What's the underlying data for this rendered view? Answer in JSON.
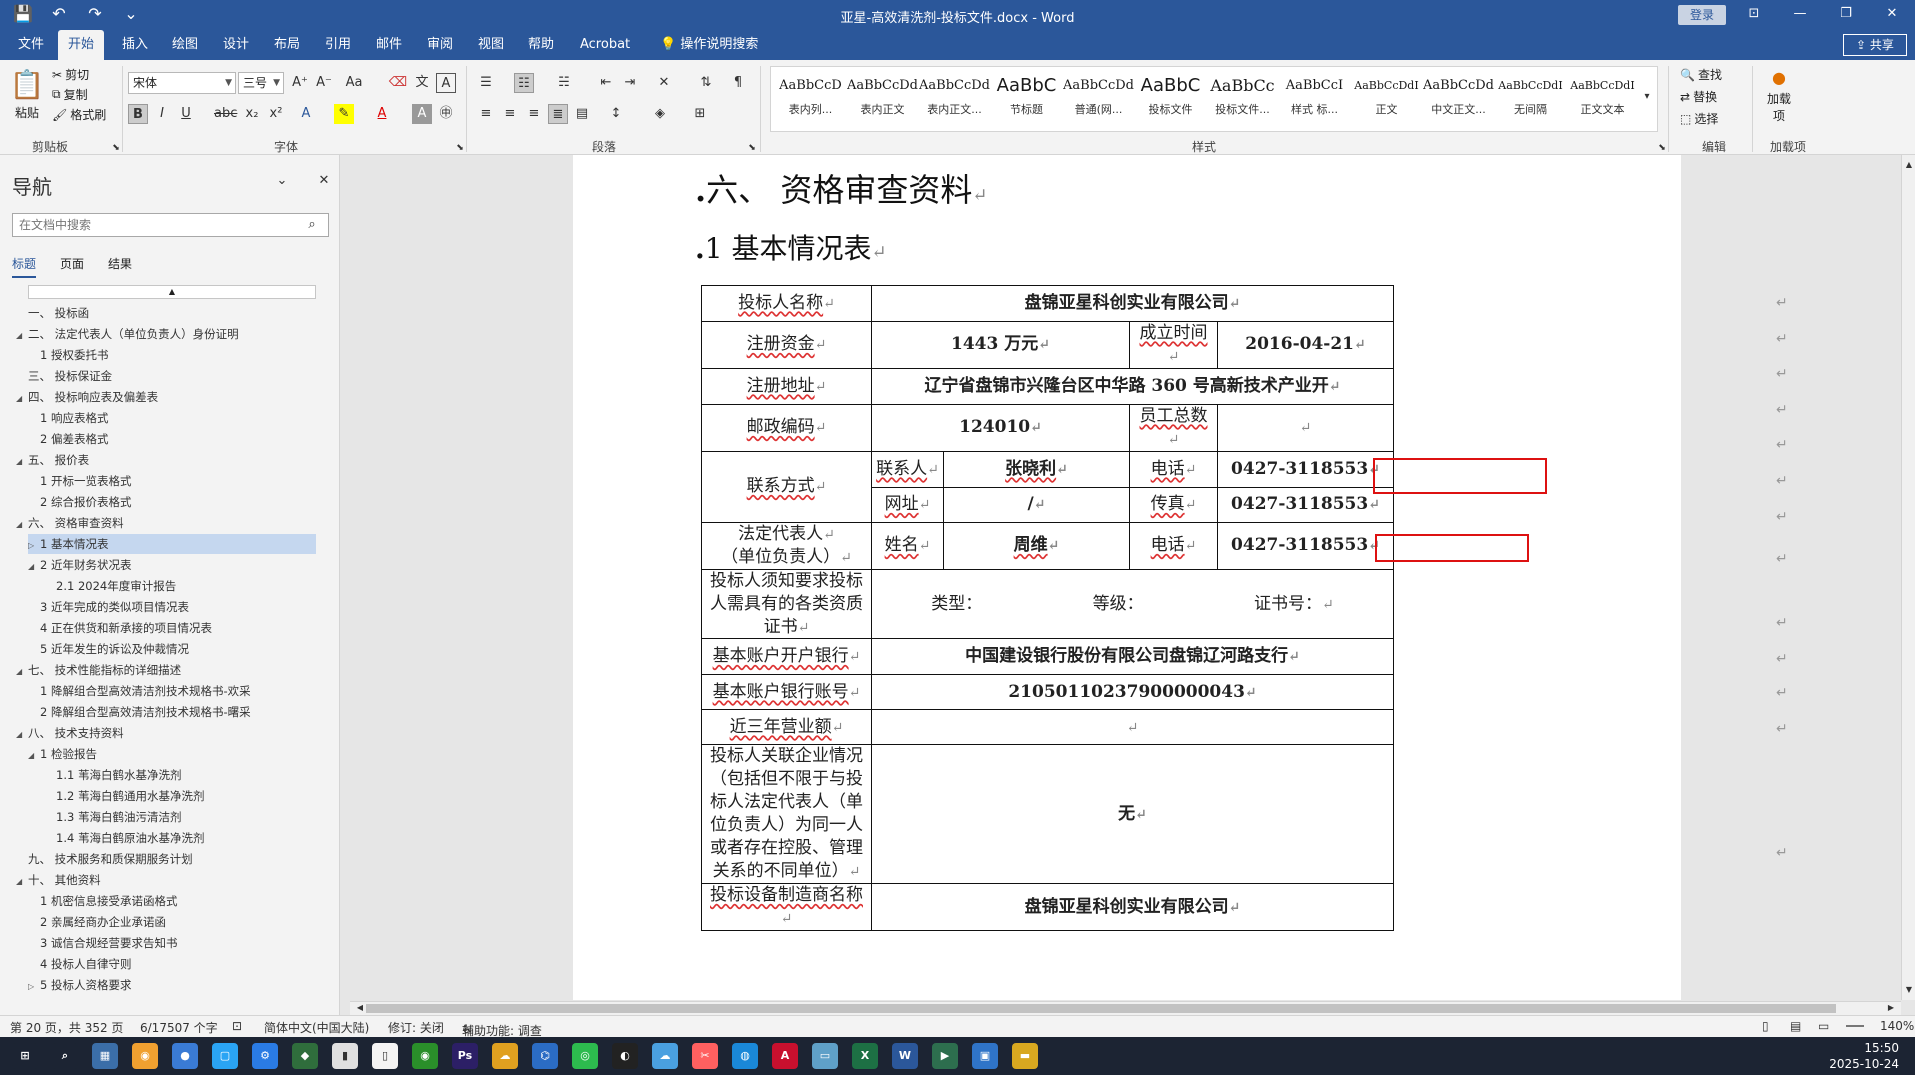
{
  "titlebar": {
    "title": "亚星-高效清洗剂-投标文件.docx  -  Word",
    "login": "登录",
    "qat": [
      "💾",
      "↶",
      "↷",
      "⌄"
    ],
    "win": [
      "⊡",
      "—",
      "❐",
      "✕"
    ]
  },
  "tabs": [
    "文件",
    "开始",
    "插入",
    "绘图",
    "设计",
    "布局",
    "引用",
    "邮件",
    "审阅",
    "视图",
    "帮助",
    "Acrobat",
    "操作说明搜索"
  ],
  "share": "共享",
  "ribbon": {
    "clipboard": {
      "paste": "粘贴",
      "cut": "剪切",
      "copy": "复制",
      "format_painter": "格式刷",
      "label": "剪贴板"
    },
    "font": {
      "name": "宋体",
      "size": "三号",
      "label": "字体"
    },
    "paragraph": {
      "label": "段落"
    },
    "styles_label": "样式",
    "styles": [
      {
        "sample": "AaBbCcD",
        "name": "表内列..."
      },
      {
        "sample": "AaBbCcDd",
        "name": "表内正文"
      },
      {
        "sample": "AaBbCcDd",
        "name": "表内正文..."
      },
      {
        "sample": "AaBbC",
        "name": "节标题"
      },
      {
        "sample": "AaBbCcDd",
        "name": "普通(网..."
      },
      {
        "sample": "AaBbC",
        "name": "投标文件"
      },
      {
        "sample": "AaBbCc",
        "name": "投标文件..."
      },
      {
        "sample": "AaBbCcI",
        "name": "样式 标..."
      },
      {
        "sample": "AaBbCcDdI",
        "name": "正文"
      },
      {
        "sample": "AaBbCcDd",
        "name": "中文正文..."
      },
      {
        "sample": "AaBbCcDdI",
        "name": "无间隔"
      },
      {
        "sample": "AaBbCcDdI",
        "name": "正文文本"
      }
    ],
    "editing": {
      "find": "查找",
      "replace": "替换",
      "select": "选择",
      "label": "编辑"
    },
    "addins": {
      "add": "加载项",
      "label": "加载项"
    }
  },
  "nav": {
    "title": "导航",
    "search_placeholder": "在文档中搜索",
    "tabs": [
      "标题",
      "页面",
      "结果"
    ],
    "items": [
      {
        "t": "一、 投标函",
        "lv": 0,
        "tw": ""
      },
      {
        "t": "二、 法定代表人（单位负责人）身份证明",
        "lv": 0,
        "tw": "◢"
      },
      {
        "t": "1 授权委托书",
        "lv": 1,
        "tw": ""
      },
      {
        "t": "三、 投标保证金",
        "lv": 0,
        "tw": ""
      },
      {
        "t": "四、 投标响应表及偏差表",
        "lv": 0,
        "tw": "◢"
      },
      {
        "t": "1 响应表格式",
        "lv": 1,
        "tw": ""
      },
      {
        "t": "2 偏差表格式",
        "lv": 1,
        "tw": ""
      },
      {
        "t": "五、 报价表",
        "lv": 0,
        "tw": "◢"
      },
      {
        "t": "1 开标一览表格式",
        "lv": 1,
        "tw": ""
      },
      {
        "t": "2 综合报价表格式",
        "lv": 1,
        "tw": ""
      },
      {
        "t": "六、 资格审查资料",
        "lv": 0,
        "tw": "◢"
      },
      {
        "t": "1 基本情况表",
        "lv": 1,
        "tw": "▷",
        "sel": true
      },
      {
        "t": "2 近年财务状况表",
        "lv": 1,
        "tw": "◢"
      },
      {
        "t": "2.1 2024年度审计报告",
        "lv": 2,
        "tw": ""
      },
      {
        "t": "3 近年完成的类似项目情况表",
        "lv": 1,
        "tw": ""
      },
      {
        "t": "4 正在供货和新承接的项目情况表",
        "lv": 1,
        "tw": ""
      },
      {
        "t": "5 近年发生的诉讼及仲裁情况",
        "lv": 1,
        "tw": ""
      },
      {
        "t": "七、 技术性能指标的详细描述",
        "lv": 0,
        "tw": "◢"
      },
      {
        "t": "1 降解组合型高效清洁剂技术规格书-欢采",
        "lv": 1,
        "tw": ""
      },
      {
        "t": "2 降解组合型高效清洁剂技术规格书-曙采",
        "lv": 1,
        "tw": ""
      },
      {
        "t": "八、 技术支持资料",
        "lv": 0,
        "tw": "◢"
      },
      {
        "t": "1 检验报告",
        "lv": 1,
        "tw": "◢"
      },
      {
        "t": "1.1 苇海白鹤水基净洗剂",
        "lv": 2,
        "tw": ""
      },
      {
        "t": "1.2 苇海白鹤通用水基净洗剂",
        "lv": 2,
        "tw": ""
      },
      {
        "t": "1.3 苇海白鹤油污清洁剂",
        "lv": 2,
        "tw": ""
      },
      {
        "t": "1.4 苇海白鹤原油水基净洗剂",
        "lv": 2,
        "tw": ""
      },
      {
        "t": "九、 技术服务和质保期服务计划",
        "lv": 0,
        "tw": ""
      },
      {
        "t": "十、 其他资料",
        "lv": 0,
        "tw": "◢"
      },
      {
        "t": "1 机密信息接受承诺函格式",
        "lv": 1,
        "tw": ""
      },
      {
        "t": "2 亲属经商办企业承诺函",
        "lv": 1,
        "tw": ""
      },
      {
        "t": "3 诚信合规经营要求告知书",
        "lv": 1,
        "tw": ""
      },
      {
        "t": "4 投标人自律守则",
        "lv": 1,
        "tw": ""
      },
      {
        "t": "5 投标人资格要求",
        "lv": 1,
        "tw": "▷"
      }
    ]
  },
  "doc": {
    "h1": "六、 资格审查资料",
    "h2": "1   基本情况表",
    "table": {
      "bidder_label": "投标人名称",
      "bidder": "盘锦亚星科创实业有限公司",
      "capital_label": "注册资金",
      "capital": "1443 万元",
      "established_label": "成立时间",
      "established": "2016-04-21",
      "address_label": "注册地址",
      "address": "辽宁省盘锦市兴隆台区中华路 360 号高新技术产业开",
      "postcode_label": "邮政编码",
      "postcode": "124010",
      "staff_label": "员工总数",
      "staff": "",
      "contact_label": "联系方式",
      "contact_person_label": "联系人",
      "contact_person": "张晓利",
      "phone_label": "电话",
      "phone": "0427-3118553",
      "website_label": "网址",
      "website": "/",
      "fax_label": "传真",
      "fax": "0427-3118553",
      "legal_rep_label_1": "法定代表人",
      "legal_rep_label_2": "（单位负责人）",
      "name_label": "姓名",
      "name": "周维",
      "phone2_label": "电话",
      "phone2": "0427-3118553",
      "qual_label": "投标人须知要求投标人需具有的各类资质证书",
      "qual_type": "类型：",
      "qual_grade": "等级：",
      "qual_cert": "证书号：",
      "bank_label": "基本账户开户银行",
      "bank": "中国建设银行股份有限公司盘锦辽河路支行",
      "account_label": "基本账户银行账号",
      "account": "21050110237900000043",
      "revenue_label": "近三年营业额",
      "revenue": "",
      "related_label": "投标人关联企业情况（包括但不限于与投标人法定代表人（单位负责人）为同一人或者存在控股、管理关系的不同单位）",
      "related": "无",
      "maker_label": "投标设备制造商名称",
      "maker": "盘锦亚星科创实业有限公司"
    }
  },
  "status": {
    "page": "第 20 页，共 352 页",
    "words": "6/17507 个字",
    "lang": "简体中文(中国大陆)",
    "track": "修订: 关闭",
    "access": "辅助功能: 调查",
    "zoom": "140%"
  },
  "taskbar": {
    "icons": [
      "start-icon",
      "search-icon",
      "calculator-icon",
      "photos-icon",
      "people-icon",
      "sticky-notes-icon",
      "settings-icon",
      "app-icon",
      "files-icon",
      "notepad-icon",
      "xbox-icon",
      "photoshop-icon",
      "weather-icon",
      "vscode-icon",
      "wechat-icon",
      "qq-icon",
      "cloud-icon",
      "snip-icon",
      "edge-icon",
      "acrobat-icon",
      "clipboard-icon",
      "excel-icon",
      "word-icon",
      "media-icon",
      "calendar-icon",
      "folder-icon"
    ],
    "time": "15:50",
    "date": "2025-10-24"
  }
}
